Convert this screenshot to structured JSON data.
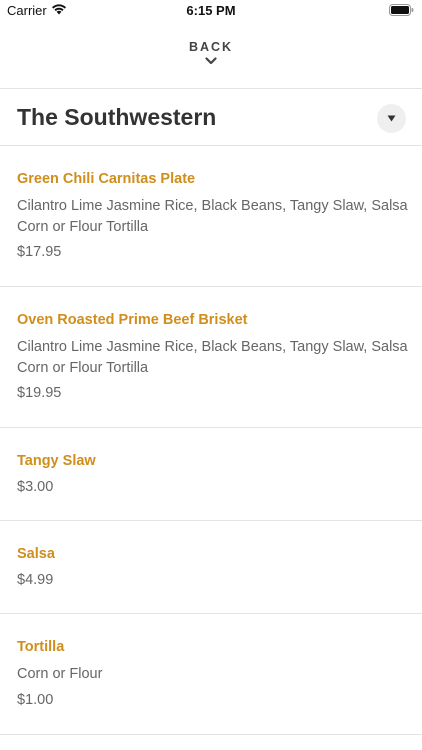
{
  "status_bar": {
    "carrier": "Carrier",
    "time": "6:15 PM",
    "wifi_icon": "wifi-icon",
    "battery_icon": "battery-icon"
  },
  "nav": {
    "back_label": "BACK",
    "back_icon": "chevron-down-icon"
  },
  "section": {
    "title": "The Southwestern",
    "dropdown_icon": "triangle-down-icon"
  },
  "colors": {
    "item_name": "#d08e1c",
    "text": "#333333",
    "muted": "#666666",
    "divider": "#e3e3e3"
  },
  "menu_items": [
    {
      "name": "Green Chili Carnitas Plate",
      "description": "Cilantro Lime Jasmine Rice, Black Beans, Tangy Slaw, Salsa Corn or Flour Tortilla",
      "price": "$17.95"
    },
    {
      "name": "Oven Roasted Prime Beef Brisket",
      "description": "Cilantro Lime Jasmine Rice, Black Beans, Tangy Slaw, Salsa Corn or Flour Tortilla",
      "price": "$19.95"
    },
    {
      "name": "Tangy Slaw",
      "description": "",
      "price": "$3.00"
    },
    {
      "name": "Salsa",
      "description": "",
      "price": "$4.99"
    },
    {
      "name": "Tortilla",
      "description": "Corn or Flour",
      "price": "$1.00"
    }
  ]
}
